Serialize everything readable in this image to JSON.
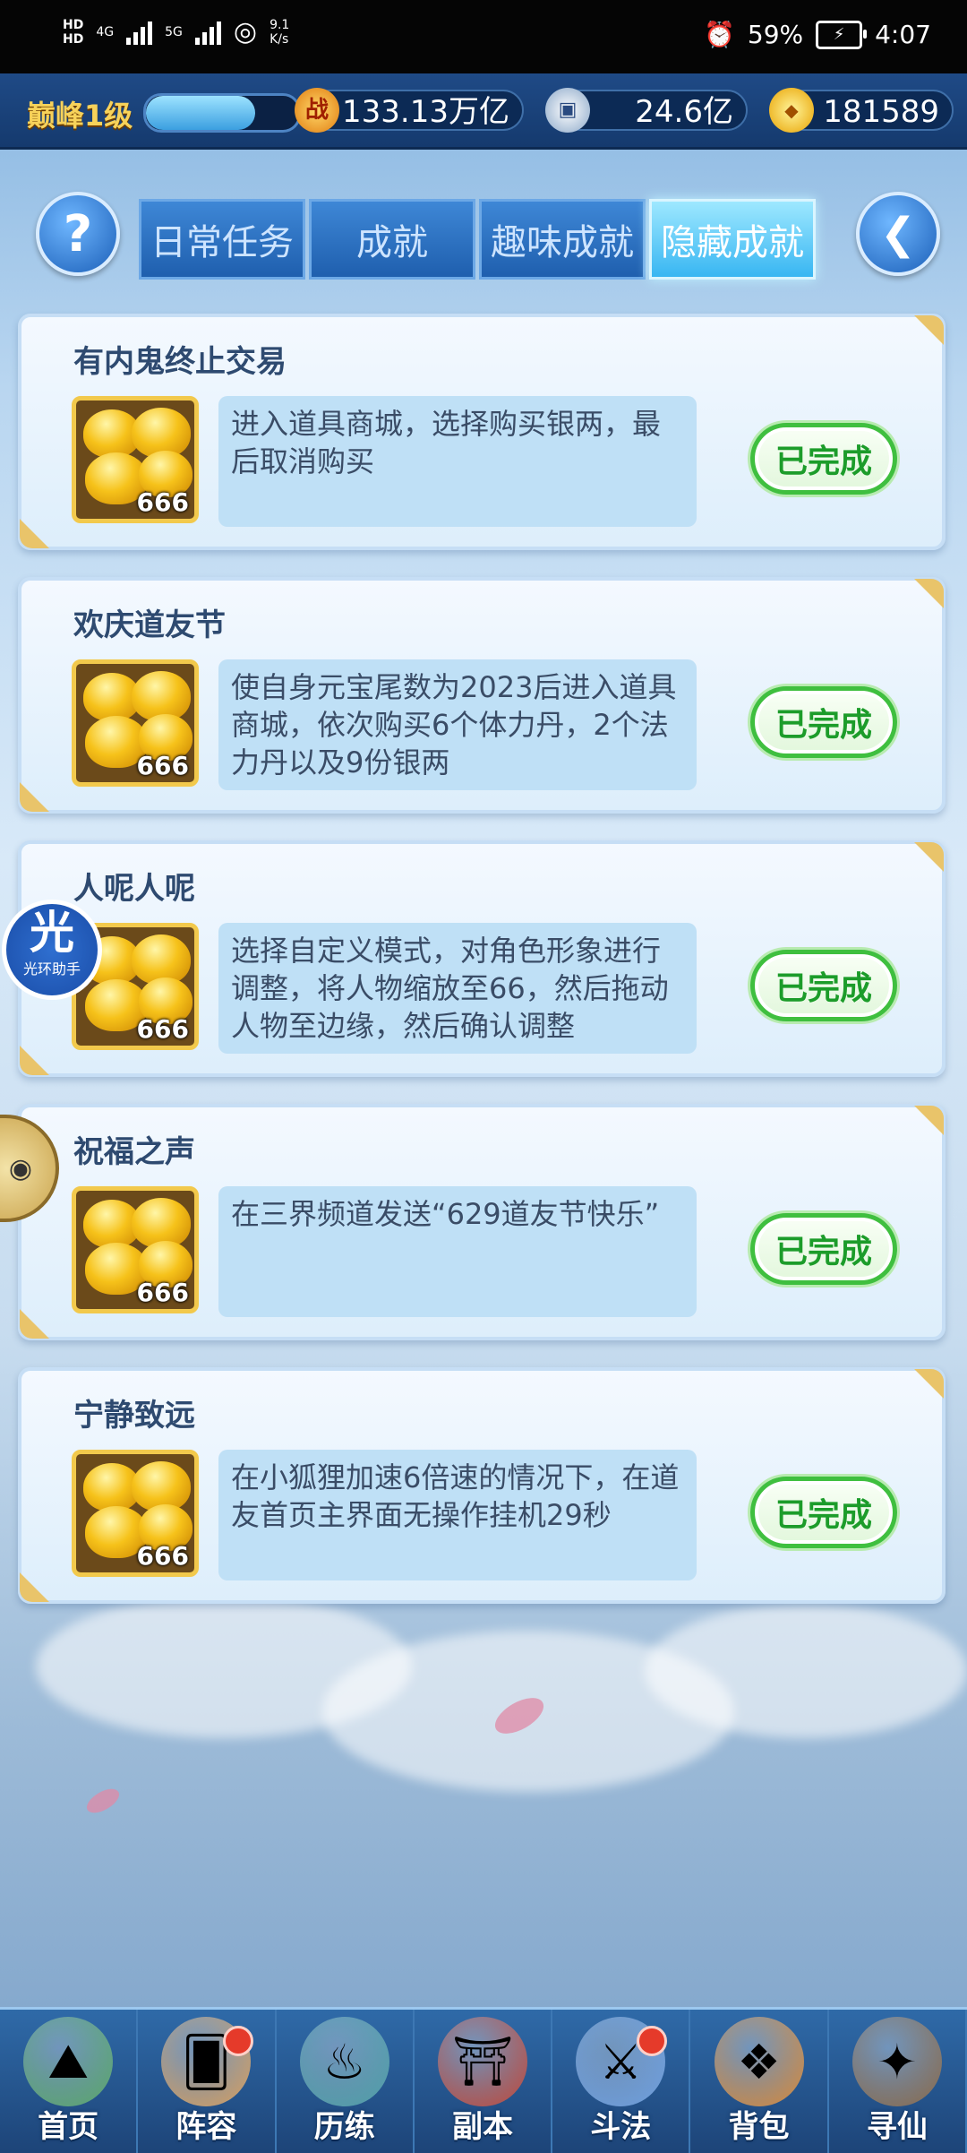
{
  "status_bar": {
    "hd1": "HD",
    "hd2": "HD",
    "net1": "4G",
    "net2": "5G",
    "speed_value": "9.1",
    "speed_unit": "K/s",
    "battery": "59%",
    "time": "4:07"
  },
  "resources": {
    "level": "巅峰1级",
    "exp_fraction": 0.72,
    "power_icon": "战",
    "power": "133.13万亿",
    "silver": "24.6亿",
    "gold": "181589"
  },
  "tabs": [
    {
      "label": "日常任务",
      "active": false
    },
    {
      "label": "成就",
      "active": false
    },
    {
      "label": "趣味成就",
      "active": false
    },
    {
      "label": "隐藏成就",
      "active": true
    }
  ],
  "icons": {
    "help": "question-icon",
    "back": "back-arrow-icon"
  },
  "achievements": [
    {
      "title": "有内鬼终止交易",
      "reward_qty": "666",
      "desc": "进入道具商城，选择购买银两，最后取消购买",
      "status": "已完成"
    },
    {
      "title": "欢庆道友节",
      "reward_qty": "666",
      "desc": "使自身元宝尾数为2023后进入道具商城，依次购买6个体力丹，2个法力丹以及9份银两",
      "status": "已完成"
    },
    {
      "title": "人呢人呢",
      "reward_qty": "666",
      "desc": "选择自定义模式，对角色形象进行调整，将人物缩放至66，然后拖动人物至边缘，然后确认调整",
      "status": "已完成"
    },
    {
      "title": "祝福之声",
      "reward_qty": "666",
      "desc": "在三界频道发送“629道友节快乐”",
      "status": "已完成"
    },
    {
      "title": "宁静致远",
      "reward_qty": "666",
      "desc": "在小狐狸加速6倍速的情况下，在道友首页主界面无操作挂机29秒",
      "status": "已完成"
    }
  ],
  "floating": {
    "helper_glyph": "光",
    "helper_label": "光环助手"
  },
  "nav": [
    {
      "label": "首页",
      "badge": false,
      "color": "#5aa86a"
    },
    {
      "label": "阵容",
      "badge": true,
      "color": "#d8a060"
    },
    {
      "label": "历练",
      "badge": false,
      "color": "#4fa0a8"
    },
    {
      "label": "副本",
      "badge": false,
      "color": "#c0483a"
    },
    {
      "label": "斗法",
      "badge": true,
      "color": "#6fa0e0"
    },
    {
      "label": "背包",
      "badge": false,
      "color": "#d88a3a"
    },
    {
      "label": "寻仙",
      "badge": false,
      "color": "#8a6a4a"
    }
  ]
}
